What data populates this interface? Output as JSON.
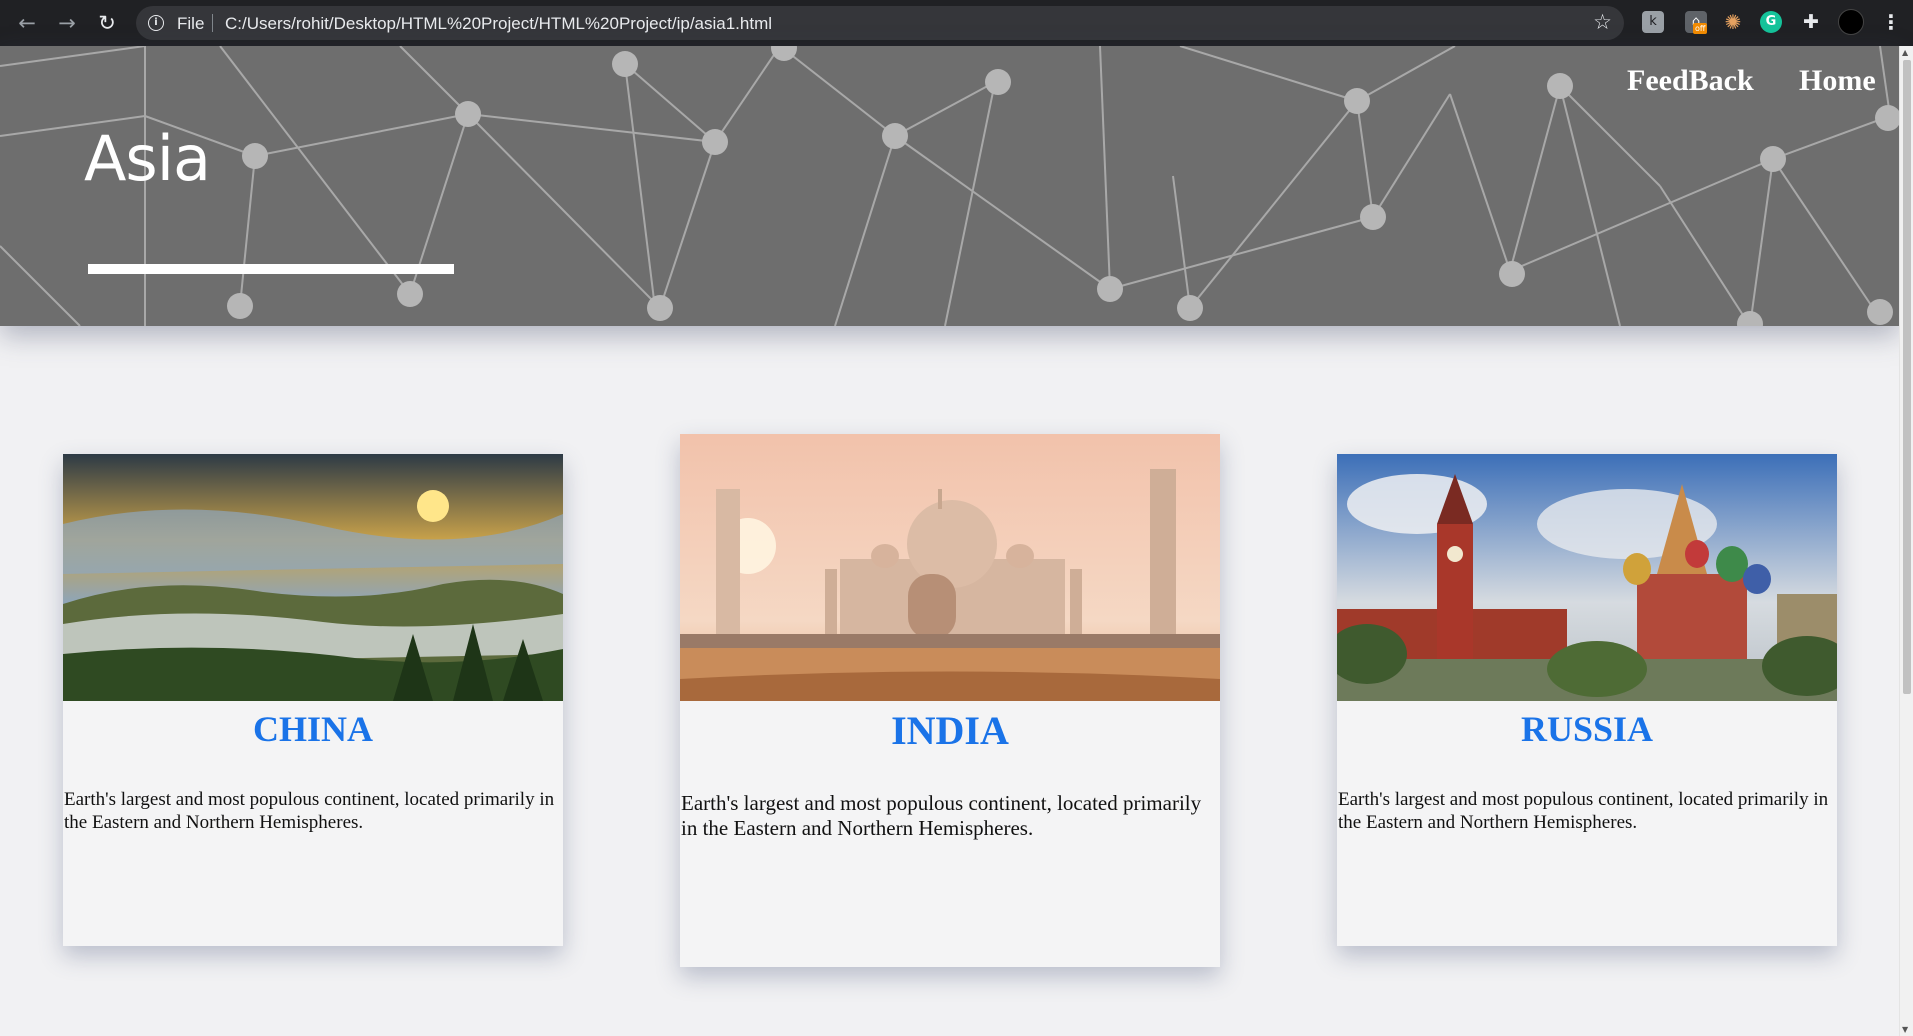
{
  "browser": {
    "file_label": "File",
    "url": "C:/Users/rohit/Desktop/HTML%20Project/HTML%20Project/ip/asia1.html",
    "ext_badge": "off"
  },
  "header": {
    "title": "Asia",
    "nav": {
      "feedback": "FeedBack",
      "home": "Home"
    }
  },
  "cards": [
    {
      "title": "CHINA",
      "text": "Earth's largest and most populous continent, located primarily in the Eastern and Northern Hemispheres."
    },
    {
      "title": "INDIA",
      "text": "Earth's largest and most populous continent, located primarily in the Eastern and Northern Hemispheres."
    },
    {
      "title": "RUSSIA",
      "text": "Earth's largest and most populous continent, located primarily in the Eastern and Northern Hemispheres."
    }
  ],
  "colors": {
    "accent": "#1a73e8",
    "hero_bg": "#6e6e6e",
    "page_bg": "#f1f1f3"
  }
}
